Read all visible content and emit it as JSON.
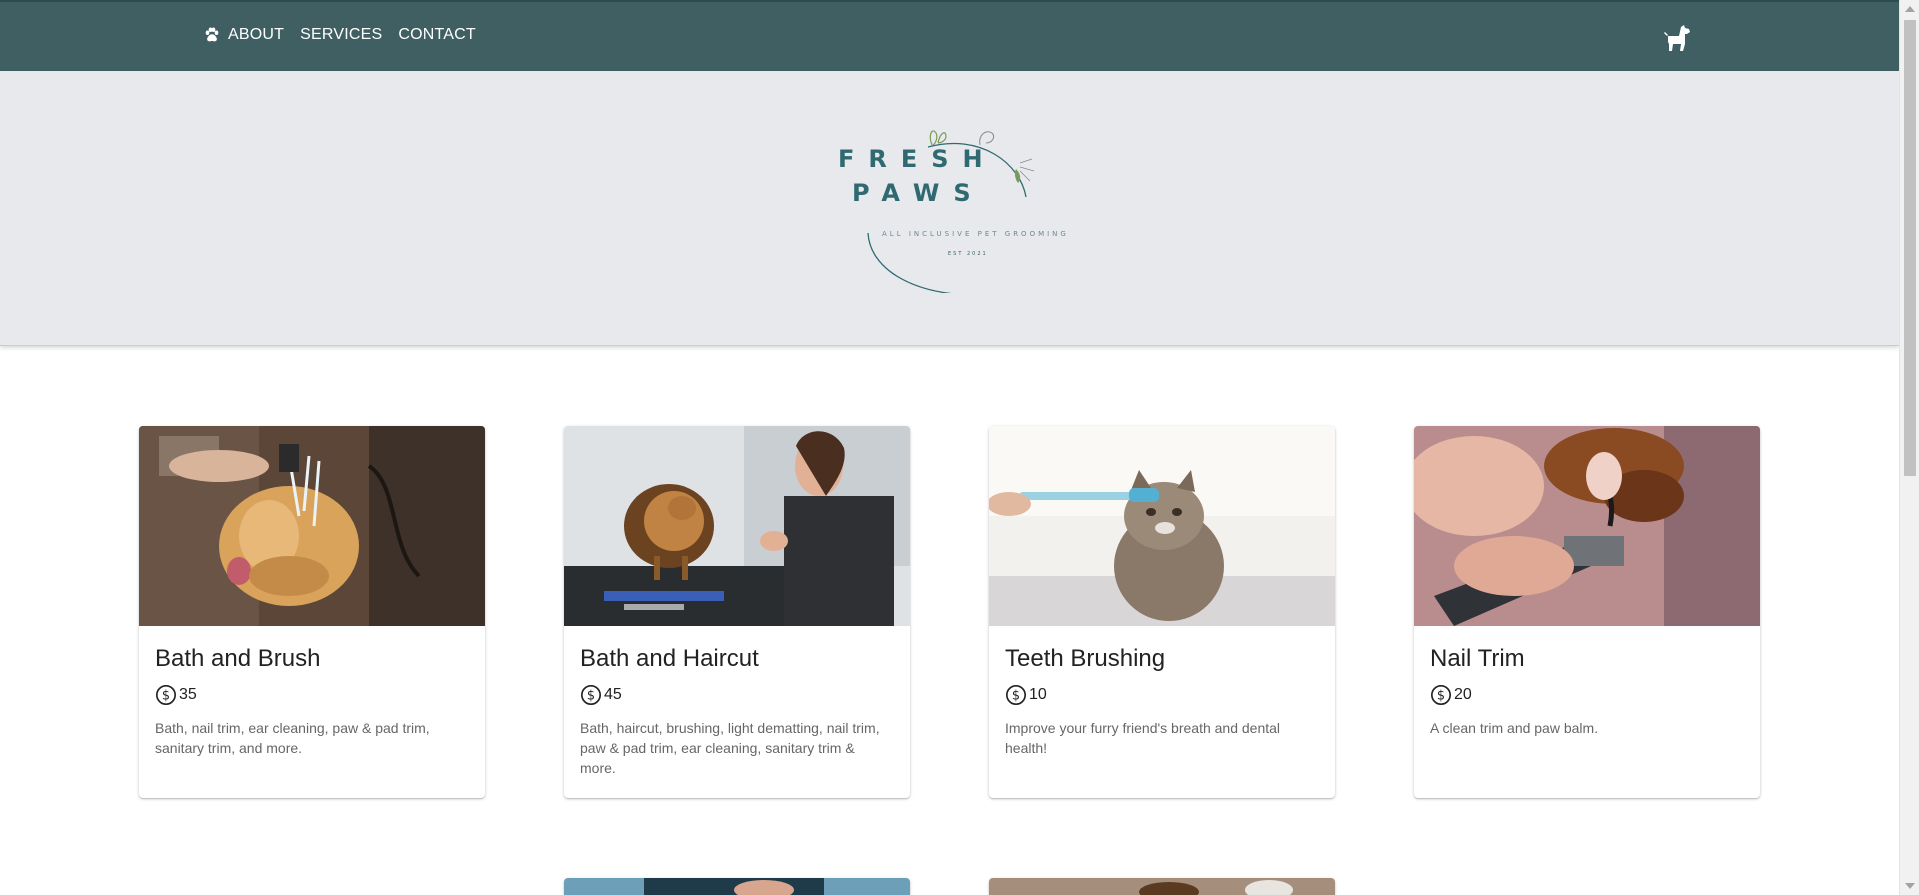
{
  "nav": {
    "links": [
      {
        "label": "ABOUT"
      },
      {
        "label": "SERVICES"
      },
      {
        "label": "CONTACT"
      }
    ],
    "paw_icon": "paw-icon",
    "cart_icon": "dog-icon"
  },
  "hero": {
    "logo": {
      "line1": "FRESH",
      "line2": "PAWS",
      "tagline": "ALL INCLUSIVE PET GROOMING",
      "est": "EST 2021"
    }
  },
  "services": [
    {
      "title": "Bath and Brush",
      "price": "35",
      "description": "Bath, nail trim, ear cleaning, paw & pad trim, sanitary trim, and more.",
      "image": "dog-bath-photo"
    },
    {
      "title": "Bath and Haircut",
      "price": "45",
      "description": "Bath, haircut, brushing, light dematting, nail trim, paw & pad trim, ear cleaning, sanitary trim & more.",
      "image": "pomeranian-grooming-photo"
    },
    {
      "title": "Teeth Brushing",
      "price": "10",
      "description": "Improve your furry friend's breath and dental health!",
      "image": "cat-toothbrush-photo"
    },
    {
      "title": "Nail Trim",
      "price": "20",
      "description": "A clean trim and paw balm.",
      "image": "nail-clipping-photo"
    }
  ],
  "colors": {
    "navbar": "#3f5f62",
    "hero_bg": "#e7e9ed",
    "brand_teal": "#2f6a70"
  }
}
